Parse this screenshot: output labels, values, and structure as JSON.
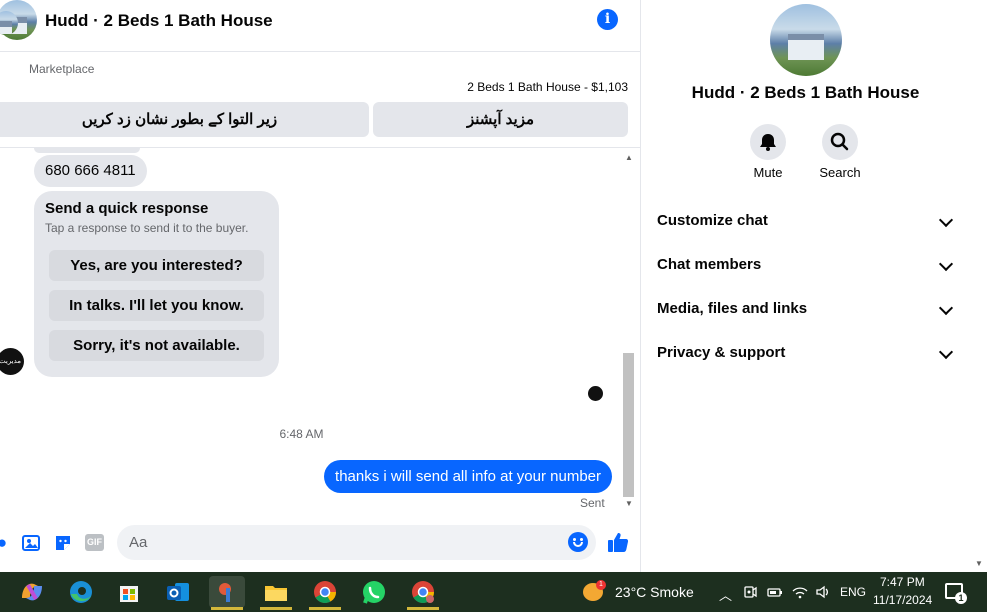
{
  "chat_header": {
    "title": "Hudd · 2 Beds 1 Bath House"
  },
  "marketplace": {
    "label": "Marketplace",
    "listing": "2 Beds 1 Bath House - $1,103",
    "mark_sold_label": "زیر التوا کے بطور نشان زد کریں",
    "more_options_label": "مزید آپشنز"
  },
  "messages": {
    "phone": "680 666 4811",
    "quick_response": {
      "title": "Send a quick response",
      "subtitle": "Tap a response to send it to the buyer.",
      "options": [
        "Yes, are you interested?",
        "In talks. I'll let you know.",
        "Sorry, it's not available."
      ]
    },
    "sender_avatar_text": "مدیریت",
    "timestamp": "6:48 AM",
    "sent_text": "thanks i will send all info at your number",
    "sent_status": "Sent"
  },
  "composer": {
    "placeholder": "Aa",
    "gif_label": "GIF"
  },
  "right_panel": {
    "name": "Hudd · 2 Beds 1 Bath House",
    "mute_label": "Mute",
    "search_label": "Search",
    "sections": [
      "Customize chat",
      "Chat members",
      "Media, files and links",
      "Privacy & support"
    ]
  },
  "taskbar": {
    "weather_temp": "23°C",
    "weather_condition": "Smoke",
    "weather_badge": "1",
    "language": "ENG",
    "time": "7:47 PM",
    "date": "11/17/2024",
    "notification_count": "1"
  },
  "colors": {
    "accent": "#0866ff",
    "bubble_gray": "#e4e6eb",
    "taskbar": "#1d2f1f"
  }
}
